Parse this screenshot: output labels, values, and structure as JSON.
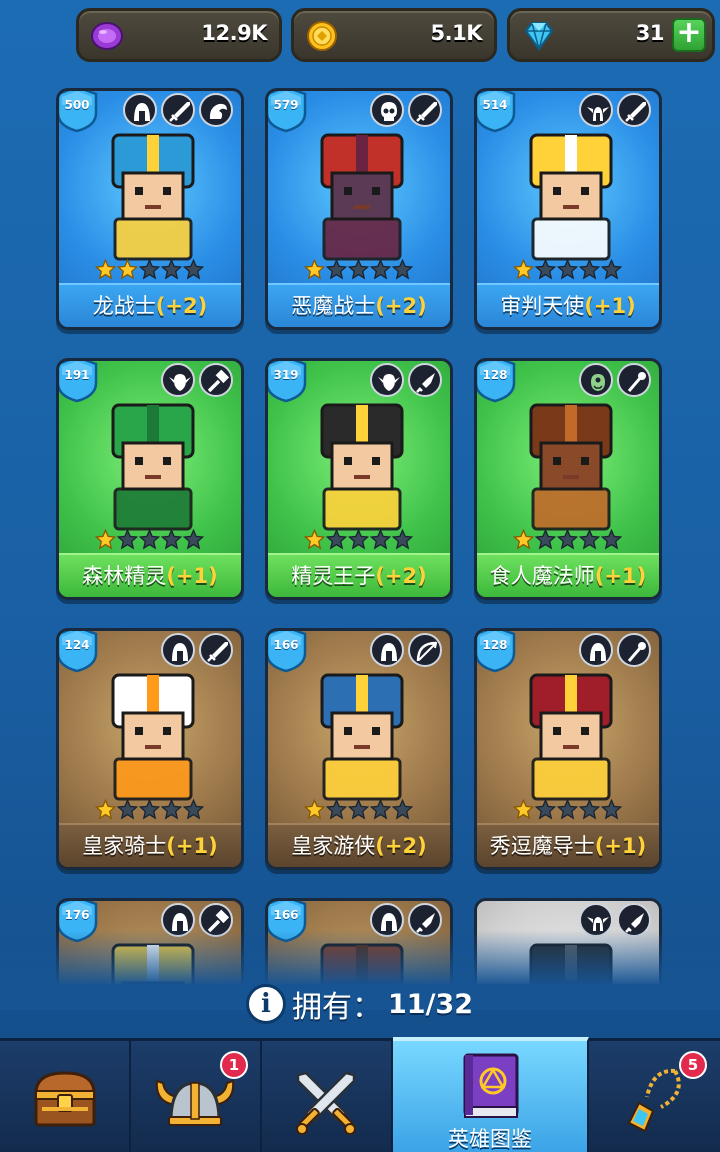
{
  "currency": {
    "gems_purple": "12.9K",
    "coins": "5.1K",
    "diamonds": "31",
    "add_label": "+"
  },
  "heroes": [
    {
      "name": "龙战士",
      "bonus": "(+2)",
      "level": "500",
      "stars": 2,
      "theme": "blue",
      "tags": [
        "helmet-icon",
        "sword-icon",
        "dragon-icon"
      ]
    },
    {
      "name": "恶魔战士",
      "bonus": "(+2)",
      "level": "579",
      "stars": 1,
      "theme": "blue",
      "tags": [
        "skull-icon",
        "sword-icon"
      ]
    },
    {
      "name": "审判天使",
      "bonus": "(+1)",
      "level": "514",
      "stars": 1,
      "theme": "blue",
      "tags": [
        "winged-helmet-icon",
        "sword-icon"
      ]
    },
    {
      "name": "森林精灵",
      "bonus": "(+1)",
      "level": "191",
      "stars": 1,
      "theme": "green",
      "tags": [
        "elf-icon",
        "hammer-icon"
      ]
    },
    {
      "name": "精灵王子",
      "bonus": "(+2)",
      "level": "319",
      "stars": 1,
      "theme": "green",
      "tags": [
        "elf-icon",
        "dagger-icon"
      ]
    },
    {
      "name": "食人魔法师",
      "bonus": "(+1)",
      "level": "128",
      "stars": 1,
      "theme": "green",
      "tags": [
        "ogre-icon",
        "staff-icon"
      ]
    },
    {
      "name": "皇家骑士",
      "bonus": "(+1)",
      "level": "124",
      "stars": 1,
      "theme": "brown",
      "tags": [
        "helmet-icon",
        "sword-icon"
      ]
    },
    {
      "name": "皇家游侠",
      "bonus": "(+2)",
      "level": "166",
      "stars": 1,
      "theme": "brown",
      "tags": [
        "helmet-icon",
        "bow-icon"
      ]
    },
    {
      "name": "秀逗魔导士",
      "bonus": "(+1)",
      "level": "128",
      "stars": 1,
      "theme": "brown",
      "tags": [
        "helmet-icon",
        "staff-icon"
      ]
    },
    {
      "name": "",
      "bonus": "",
      "level": "176",
      "stars": 0,
      "theme": "brown",
      "tags": [
        "helmet-icon",
        "hammer-icon"
      ]
    },
    {
      "name": "",
      "bonus": "",
      "level": "166",
      "stars": 0,
      "theme": "brown",
      "tags": [
        "helmet-icon",
        "dagger-icon"
      ]
    },
    {
      "name": "",
      "bonus": "",
      "level": "",
      "stars": 0,
      "theme": "grey",
      "tags": [
        "winged-helmet-icon",
        "dagger-icon"
      ]
    }
  ],
  "owned": {
    "label": "拥有：",
    "count": "11/32"
  },
  "nav": {
    "chest_badge": "",
    "heroes_badge": "1",
    "collection_label": "英雄图鉴",
    "amulet_badge": "5"
  },
  "colors": {
    "background": "#1a5fa3",
    "star_gold": "#ffc928",
    "bonus_yellow": "#ffd23a",
    "badge_red": "#e22a4e",
    "level_badge": "#3bb4f6"
  }
}
